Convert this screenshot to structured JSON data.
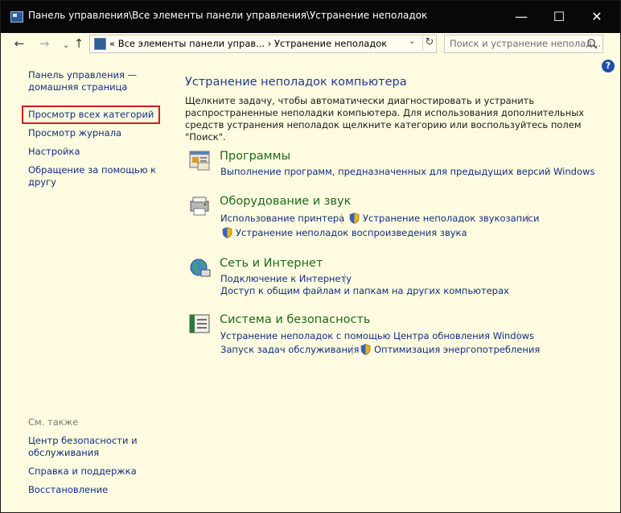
{
  "window": {
    "title": "Панель управления\\Все элементы панели управления\\Устранение неполадок",
    "minimize_glyph": "—",
    "maximize_glyph": "☐",
    "close_glyph": "✕"
  },
  "nav": {
    "back_glyph": "←",
    "forward_glyph": "→",
    "up_glyph": "↑",
    "breadcrumb": "«  Все элементы панели управ...  ›  Устранение неполадок",
    "dropdown_glyph": "⌄",
    "refresh_glyph": "↻",
    "search_placeholder": "Поиск и устранение неполад..."
  },
  "help_glyph": "?",
  "sidebar": {
    "home_line1": "Панель управления —",
    "home_line2": "домашняя страница",
    "items": [
      {
        "label": "Просмотр всех категорий"
      },
      {
        "label": "Просмотр журнала"
      },
      {
        "label": "Настройка"
      },
      {
        "label_line1": "Обращение за помощью к",
        "label_line2": "другу"
      }
    ],
    "see_also_heading": "См. также",
    "see_also": [
      {
        "label_line1": "Центр безопасности и",
        "label_line2": "обслуживания"
      },
      {
        "label": "Справка и поддержка"
      },
      {
        "label": "Восстановление"
      }
    ]
  },
  "main": {
    "title": "Устранение неполадок компьютера",
    "description": "Щелкните задачу, чтобы автоматически диагностировать и устранить распространенные неполадки компьютера. Для использования дополнительных средств устранения неполадок щелкните категорию или воспользуйтесь полем \"Поиск\".",
    "categories": [
      {
        "title": "Программы",
        "links": [
          "Выполнение программ, предназначенных для предыдущих версий Windows"
        ]
      },
      {
        "title": "Оборудование и звук",
        "links": [
          "Использование принтера",
          "Устранение неполадок звукозаписи",
          "Устранение неполадок воспроизведения звука"
        ]
      },
      {
        "title": "Сеть и Интернет",
        "links": [
          "Подключение к Интернету",
          "Доступ к общим файлам и папкам на других компьютерах"
        ]
      },
      {
        "title": "Система и безопасность",
        "links": [
          "Устранение неполадок с помощью Центра обновления Windows",
          "Запуск задач обслуживания",
          "Оптимизация энергопотребления"
        ]
      }
    ]
  },
  "colors": {
    "background": "#fffbe0",
    "titlebar": "#080808",
    "link": "#0d2f82",
    "heading": "#1e3c8c",
    "category": "#1c6b1c",
    "selection_border": "#d21c1c"
  }
}
